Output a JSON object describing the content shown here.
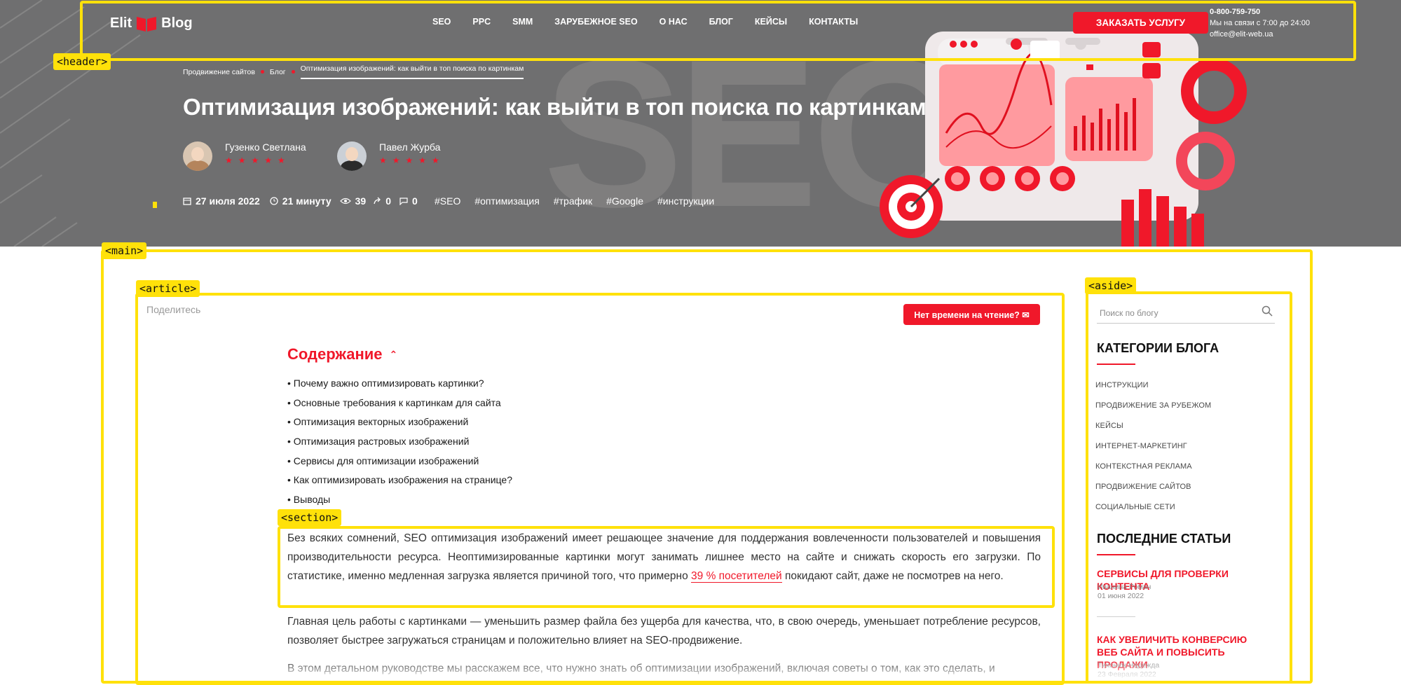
{
  "header": {
    "logo_left": "Elit",
    "logo_right": "Blog",
    "nav": [
      "SEO",
      "PPC",
      "SMM",
      "ЗАРУБЕЖНОЕ SEO",
      "О НАС",
      "БЛОГ",
      "КЕЙСЫ",
      "КОНТАКТЫ"
    ],
    "order_button": "ЗАКАЗАТЬ УСЛУГУ",
    "phone": "0-800-759-750",
    "hours": "Мы на связи с 7:00 до 24:00",
    "email": "office@elit-web.ua"
  },
  "hero": {
    "bg_text": "SEO",
    "breadcrumb": [
      "Продвижение сайтов",
      "Блог",
      "Оптимизация изображений: как выйти в топ поиска по картинкам"
    ],
    "title": "Оптимизация изображений: как выйти в топ поиска по картинкам",
    "authors": [
      {
        "name": "Гузенко Светлана",
        "stars": "★★★★★"
      },
      {
        "name": "Павел Журба",
        "stars": "★★★★★"
      }
    ],
    "date": "27 июля 2022",
    "read_time": "21 минуту",
    "views": "39",
    "shares": "0",
    "comments": "0",
    "tags": [
      "#SEO",
      "#оптимизация",
      "#трафик",
      "#Google",
      "#инструкции"
    ]
  },
  "labels": {
    "header": "<header>",
    "main": "<main>",
    "article": "<article>",
    "aside": "<aside>",
    "section": "<section>"
  },
  "article": {
    "share": "Поделитесь",
    "no_time_button": "Нет времени на чтение?",
    "toc_title": "Содержание",
    "toc": [
      "Почему важно оптимизировать картинки?",
      "Основные требования к картинкам для сайта",
      "Оптимизация векторных изображений",
      "Оптимизация растровых изображений",
      "Сервисы для оптимизации изображений",
      "Как оптимизировать изображения на странице?",
      "Выводы"
    ],
    "p1_before": "Без всяких сомнений, SEO оптимизация изображений имеет решающее значение для поддержания вовлеченности пользователей и повышения производительности ресурса. Неоптимизированные картинки могут занимать лишнее место на сайте и снижать скорость его загрузки. По статистике, именно медленная загрузка является причиной того, что примерно",
    "p1_link": "39 % посетителей",
    "p1_after": "покидают сайт, даже не посмотрев на него.",
    "p2": "Главная цель работы с картинками — уменьшить размер файла без ущерба для качества, что, в свою очередь, уменьшает потребление ресурсов, позволяет быстрее загружаться страницам и положительно влияет на SEO-продвижение.",
    "p3": "В этом детальном руководстве мы расскажем все, что нужно знать об оптимизации изображений, включая советы о том, как это сделать, и"
  },
  "aside": {
    "search_placeholder": "Поиск по блогу",
    "categories_title": "КАТЕГОРИИ БЛОГА",
    "categories": [
      "ИНСТРУКЦИИ",
      "ПРОДВИЖЕНИЕ ЗА РУБЕЖОМ",
      "КЕЙСЫ",
      "ИНТЕРНЕТ-МАРКЕТИНГ",
      "КОНТЕКСТНАЯ РЕКЛАМА",
      "ПРОДВИЖЕНИЕ САЙТОВ",
      "СОЦИАЛЬНЫЕ СЕТИ"
    ],
    "recent_title": "ПОСЛЕДНИЕ СТАТЬИ",
    "posts": [
      {
        "title": "СЕРВИСЫ ДЛЯ ПРОВЕРКИ КОНТЕНТА",
        "author": "Иванина Роман",
        "date": "01 июня 2022"
      },
      {
        "title": "КАК УВЕЛИЧИТЬ КОНВЕРСИЮ ВЕБ САЙТА И ПОВЫСИТЬ ПРОДАЖИ",
        "author": "Тихонюк Надежда",
        "date": "23 Февраля 2022"
      }
    ]
  },
  "colors": {
    "accent": "#f0182a",
    "annotation": "#ffe10a",
    "hero_bg": "#6f6f70"
  }
}
